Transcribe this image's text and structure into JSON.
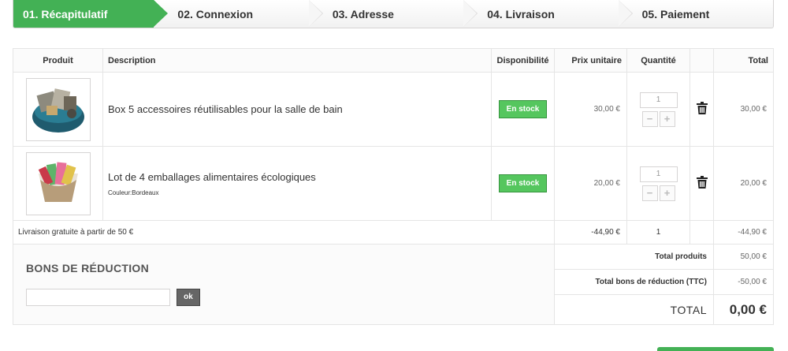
{
  "steps": [
    {
      "label": "01. Récapitulatif",
      "active": true
    },
    {
      "label": "02. Connexion",
      "active": false
    },
    {
      "label": "03. Adresse",
      "active": false
    },
    {
      "label": "04. Livraison",
      "active": false
    },
    {
      "label": "05. Paiement",
      "active": false
    }
  ],
  "table": {
    "headers": {
      "product": "Produit",
      "description": "Description",
      "availability": "Disponibilité",
      "unit_price": "Prix unitaire",
      "quantity": "Quantité",
      "total": "Total"
    },
    "rows": [
      {
        "name": "Box 5 accessoires réutilisables pour la salle de bain",
        "attribute": "",
        "availability": "En stock",
        "unit_price": "30,00 €",
        "quantity": "1",
        "total": "30,00 €"
      },
      {
        "name": "Lot de 4 emballages alimentaires écologiques",
        "attribute": "Couleur:Bordeaux",
        "availability": "En stock",
        "unit_price": "20,00 €",
        "quantity": "1",
        "total": "20,00 €"
      }
    ],
    "shipping": {
      "label": "Livraison gratuite à partir de 50 €",
      "price": "-44,90 €",
      "quantity": "1",
      "total": "-44,90 €"
    }
  },
  "voucher": {
    "title": "Bons de réduction",
    "input_value": "",
    "button_label": "ok"
  },
  "summary": {
    "total_products_label": "Total produits",
    "total_products_value": "50,00 €",
    "total_vouchers_label": "Total bons de réduction (TTC)",
    "total_vouchers_value": "-50,00 €",
    "grand_total_label": "TOTAL",
    "grand_total_value": "0,00 €"
  },
  "colors": {
    "accent": "#43b155",
    "badge": "#55c65e"
  },
  "icons": {
    "delete": "trash-icon",
    "increment": "plus-icon",
    "decrement": "minus-icon"
  }
}
